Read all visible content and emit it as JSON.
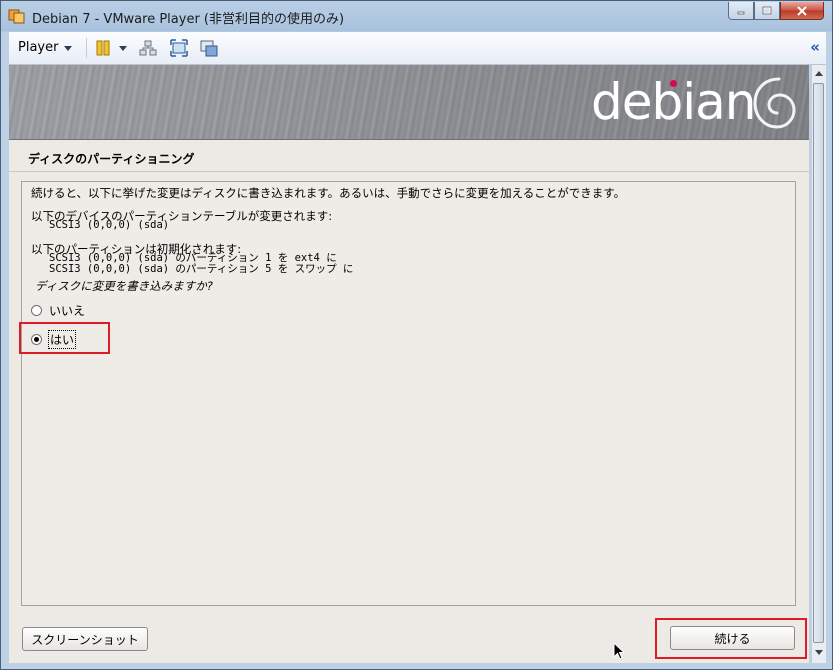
{
  "window": {
    "title": "Debian 7 - VMware Player (非営利目的の使用のみ)"
  },
  "toolbar": {
    "player_label": "Player"
  },
  "installer": {
    "logo_text": "debian",
    "section_title": "ディスクのパーティショニング",
    "description": "続けると、以下に挙げた変更はディスクに書き込まれます。あるいは、手動でさらに変更を加えることができます。",
    "devices_label": "以下のデバイスのパーティションテーブルが変更されます:",
    "devices": [
      "SCSI3 (0,0,0) (sda)"
    ],
    "partitions_label": "以下のパーティションは初期化されます:",
    "partitions": [
      "SCSI3 (0,0,0) (sda) のパーティション 1 を ext4 に",
      "SCSI3 (0,0,0) (sda) のパーティション 5 を スワップ に"
    ],
    "question": "ディスクに変更を書き込みますか?",
    "options": [
      {
        "label": "いいえ",
        "selected": false
      },
      {
        "label": "はい",
        "selected": true
      }
    ],
    "screenshot_button": "スクリーンショット",
    "continue_button": "続ける"
  },
  "colors": {
    "highlight": "#e01b24",
    "debian_red": "#d70751"
  }
}
